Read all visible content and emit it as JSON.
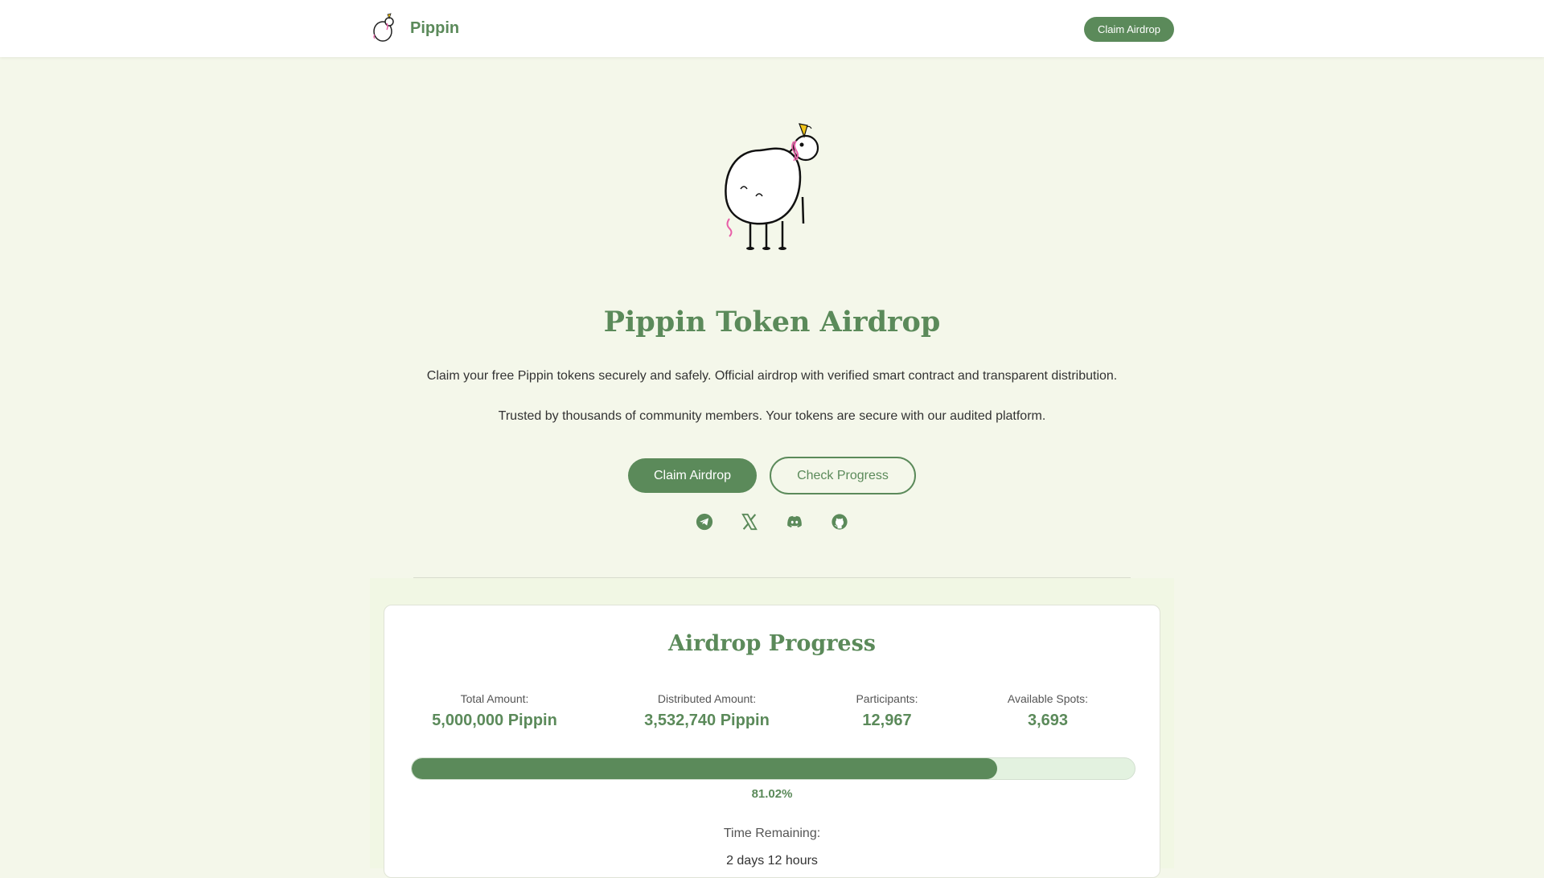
{
  "navbar": {
    "brand_name": "Pippin",
    "claim_button": "Claim Airdrop"
  },
  "hero": {
    "title": "Pippin Token Airdrop",
    "description_1": "Claim your free Pippin tokens securely and safely. Official airdrop with verified smart contract and transparent distribution.",
    "description_2": "Trusted by thousands of community members. Your tokens are secure with our audited platform.",
    "primary_button": "Claim Airdrop",
    "secondary_button": "Check Progress"
  },
  "socials": [
    "telegram-icon",
    "x-icon",
    "discord-icon",
    "github-icon"
  ],
  "progress": {
    "title": "Airdrop Progress",
    "stats": [
      {
        "label": "Total Amount:",
        "value": "5,000,000 Pippin"
      },
      {
        "label": "Distributed Amount:",
        "value": "3,532,740 Pippin"
      },
      {
        "label": "Participants:",
        "value": "12,967"
      },
      {
        "label": "Available Spots:",
        "value": "3,693"
      }
    ],
    "percent": 81.02,
    "percent_label": "81.02%",
    "time_label": "Time Remaining:",
    "time_value": "2 days 12 hours"
  },
  "colors": {
    "accent": "#5b8a5a",
    "background": "#f4f7ea",
    "track": "#e3f2e0"
  }
}
